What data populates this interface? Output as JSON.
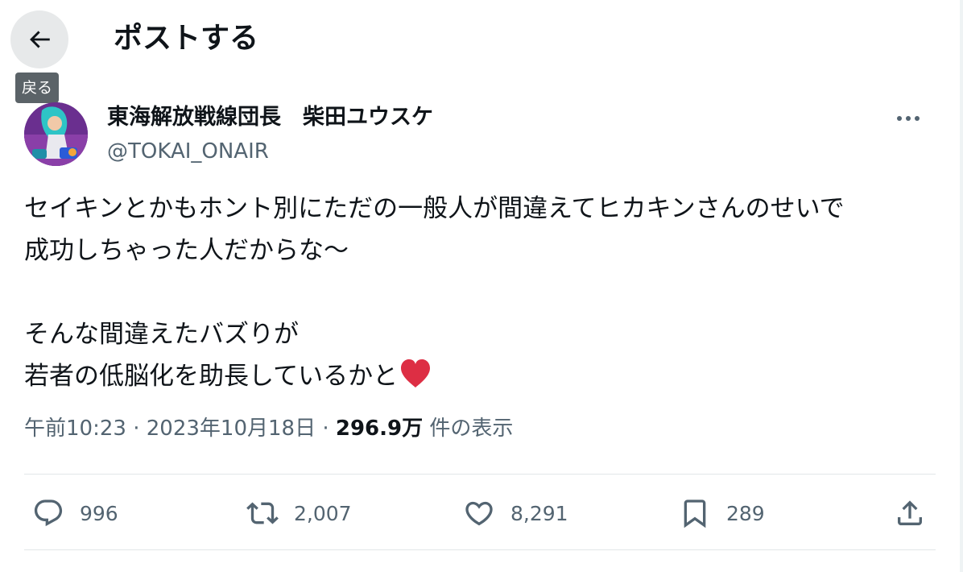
{
  "header": {
    "title": "ポストする",
    "back_tooltip": "戻る"
  },
  "author": {
    "display_name": "東海解放戦線団長　柴田ユウスケ",
    "handle": "@TOKAI_ONAIR"
  },
  "post": {
    "text": "セイキンとかもホント別にただの一般人が間違えてヒカキンさんのせいで\n成功しちゃった人だからな〜\n\nそんな間違えたバズりが\n若者の低脳化を助長しているかと",
    "emoji": "heart-emoji"
  },
  "meta": {
    "time": "午前10:23",
    "separator": " · ",
    "date": "2023年10月18日",
    "views": "296.9万",
    "views_label": "件の表示"
  },
  "actions": {
    "replies": "996",
    "reposts": "2,007",
    "likes": "8,291",
    "bookmarks": "289"
  },
  "colors": {
    "text_primary": "#0f1419",
    "text_secondary": "#536471",
    "divider": "#e2e6e8",
    "back_button_bg": "#e7e9ea",
    "tooltip_bg": "#5b6368",
    "emoji_red": "#dd2e44"
  }
}
